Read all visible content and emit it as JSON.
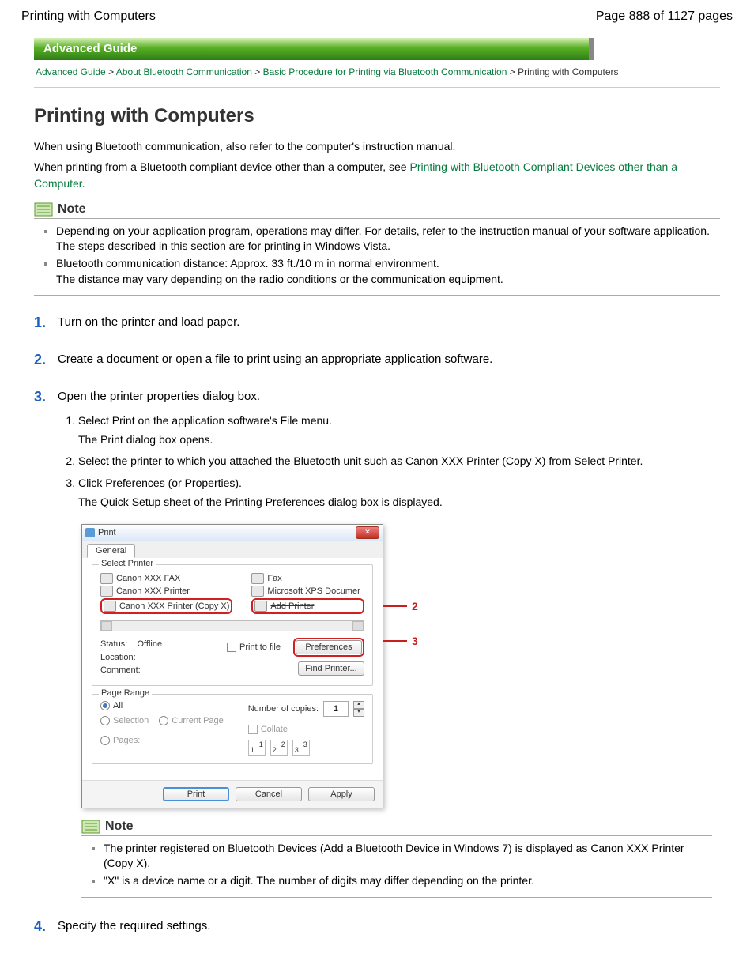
{
  "page_header": {
    "left": "Printing with Computers",
    "right": "Page 888 of 1127 pages"
  },
  "guide_bar": "Advanced Guide",
  "breadcrumb": {
    "l1": "Advanced Guide",
    "l2": "About Bluetooth Communication",
    "l3": "Basic Procedure for Printing via Bluetooth Communication",
    "current": "Printing with Computers",
    "sep": ">"
  },
  "title": "Printing with Computers",
  "intro_1": "When using Bluetooth communication, also refer to the computer's instruction manual.",
  "intro_2a": "When printing from a Bluetooth compliant device other than a computer, see ",
  "intro_2_link": "Printing with Bluetooth Compliant Devices other than a Computer",
  "intro_2_period": ".",
  "note_label": "Note",
  "note1_a": "Depending on your application program, operations may differ. For details, refer to the instruction manual of your software application.",
  "note1_b": "The steps described in this section are for printing in Windows Vista.",
  "note2_a": "Bluetooth communication distance: Approx. 33 ft./10 m in normal environment.",
  "note2_b": "The distance may vary depending on the radio conditions or the communication equipment.",
  "steps": {
    "s1": {
      "num": "1.",
      "text": "Turn on the printer and load paper."
    },
    "s2": {
      "num": "2.",
      "text": "Create a document or open a file to print using an appropriate application software."
    },
    "s3": {
      "num": "3.",
      "text": "Open the printer properties dialog box.",
      "sub": {
        "a_main": "Select Print on the application software's File menu.",
        "a_desc": "The Print dialog box opens.",
        "b_main": "Select the printer to which you attached the Bluetooth unit such as Canon XXX Printer (Copy X) from Select Printer.",
        "c_main": "Click Preferences (or Properties).",
        "c_desc": "The Quick Setup sheet of the Printing Preferences dialog box is displayed."
      }
    },
    "s4": {
      "num": "4.",
      "text": "Specify the required settings."
    }
  },
  "dialog": {
    "title": "Print",
    "tab": "General",
    "grp_select": "Select Printer",
    "printers_left": [
      "Canon XXX FAX",
      "Canon XXX Printer",
      "Canon XXX Printer (Copy X)"
    ],
    "printers_right": [
      "Fax",
      "Microsoft XPS Documer",
      "Add Printer"
    ],
    "status_lbl": "Status:",
    "status_val": "Offline",
    "location_lbl": "Location:",
    "comment_lbl": "Comment:",
    "print_to_file": "Print to file",
    "preferences": "Preferences",
    "find_printer": "Find Printer...",
    "grp_range": "Page Range",
    "all": "All",
    "selection": "Selection",
    "current": "Current Page",
    "pages_lbl": "Pages:",
    "copies_lbl": "Number of copies:",
    "copies_val": "1",
    "collate": "Collate",
    "btn_print": "Print",
    "btn_cancel": "Cancel",
    "btn_apply": "Apply"
  },
  "callouts": {
    "c2": "2",
    "c3": "3"
  },
  "inner_note": {
    "label": "Note",
    "n1": "The printer registered on Bluetooth Devices (Add a Bluetooth Device in Windows 7) is displayed as Canon XXX Printer (Copy X).",
    "n2": "\"X\" is a device name or a digit. The number of digits may differ depending on the printer."
  }
}
